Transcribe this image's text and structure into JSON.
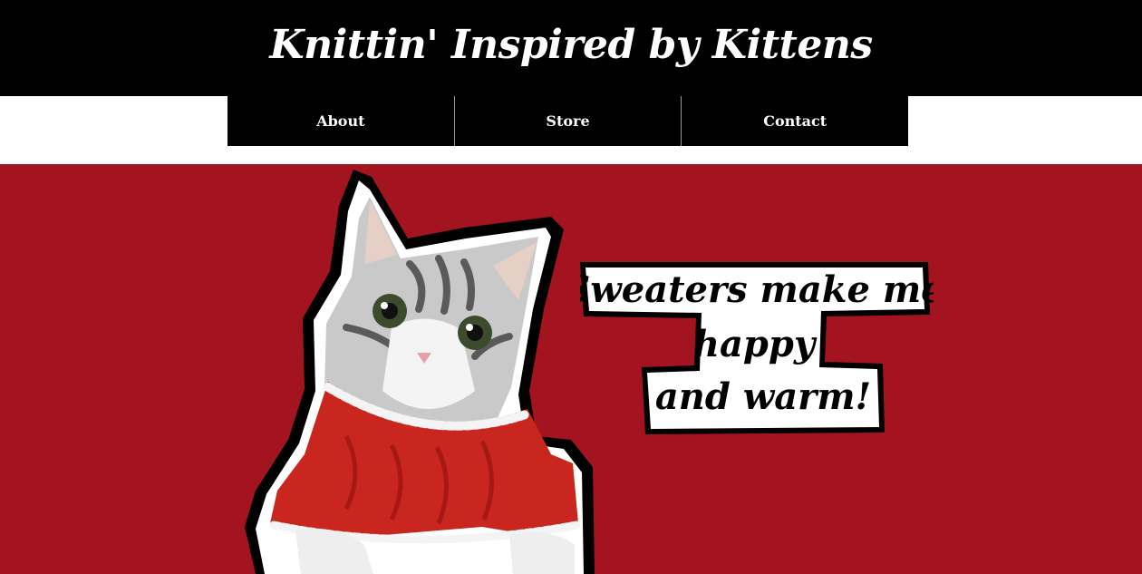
{
  "header": {
    "title": "Knittin' Inspired by Kittens"
  },
  "nav": {
    "items": [
      {
        "label": "About"
      },
      {
        "label": "Store"
      },
      {
        "label": "Contact"
      }
    ]
  },
  "hero": {
    "speech_lines": [
      "Sweaters make me",
      "happy",
      "and warm!"
    ],
    "image_subject": "cat-in-red-sweater"
  },
  "colors": {
    "header_bg": "#000000",
    "nav_bg": "#000000",
    "hero_bg": "#a31420",
    "sweater_red": "#c8261f",
    "text_light": "#ffffff"
  }
}
